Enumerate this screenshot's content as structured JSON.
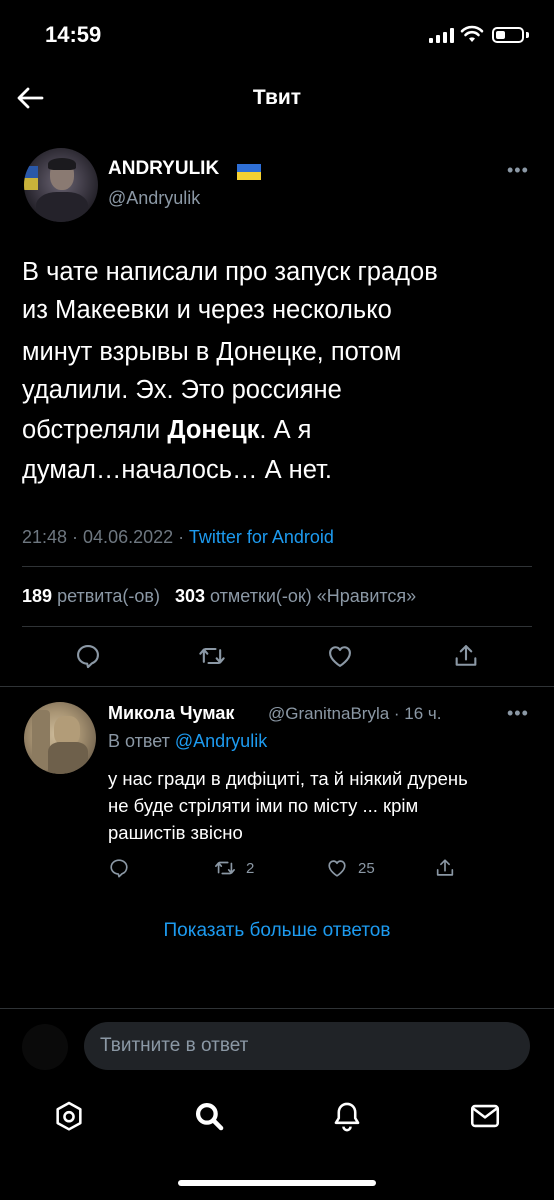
{
  "status_bar": {
    "time": "14:59"
  },
  "header": {
    "title": "Твит"
  },
  "tweet": {
    "author_name": "ANDRYULIK",
    "author_handle": "@Andryulik",
    "text_lines": [
      "В чате написали про запуск градов",
      "из Макеевки и через несколько",
      "минут взрывы в Донецке, потом",
      "удалили. Эх. Это россияне"
    ],
    "line5_before": "обстреляли ",
    "line5_bold": "Донецк",
    "line5_after": ". А я",
    "line6": "думал…началось… А нет.",
    "meta_time": "21:48 · 04.06.2022 · ",
    "meta_source": "Twitter for Android",
    "retweets_count": "189",
    "retweets_label": "ретвита(-ов)",
    "likes_count": "303",
    "likes_label": "отметки(-ок) «Нравится»"
  },
  "reply": {
    "author_name": "Микола Чумак",
    "author_handle_time": "@GranitnaBryla · 16 ч.",
    "reply_to_label": "В ответ ",
    "reply_to_mention": "@Andryulik",
    "text_lines": [
      "у нас гради в дифіциті, та й ніякий дурень",
      "не буде стріляти іми по місту ... крім",
      "рашистів звісно"
    ],
    "retweets": "2",
    "likes": "25"
  },
  "show_more": "Показать больше ответов",
  "compose": {
    "placeholder": "Твитните в ответ"
  },
  "colors": {
    "background": "#000000",
    "accent": "#1d9bf0",
    "secondary_text": "#8b98a5"
  }
}
